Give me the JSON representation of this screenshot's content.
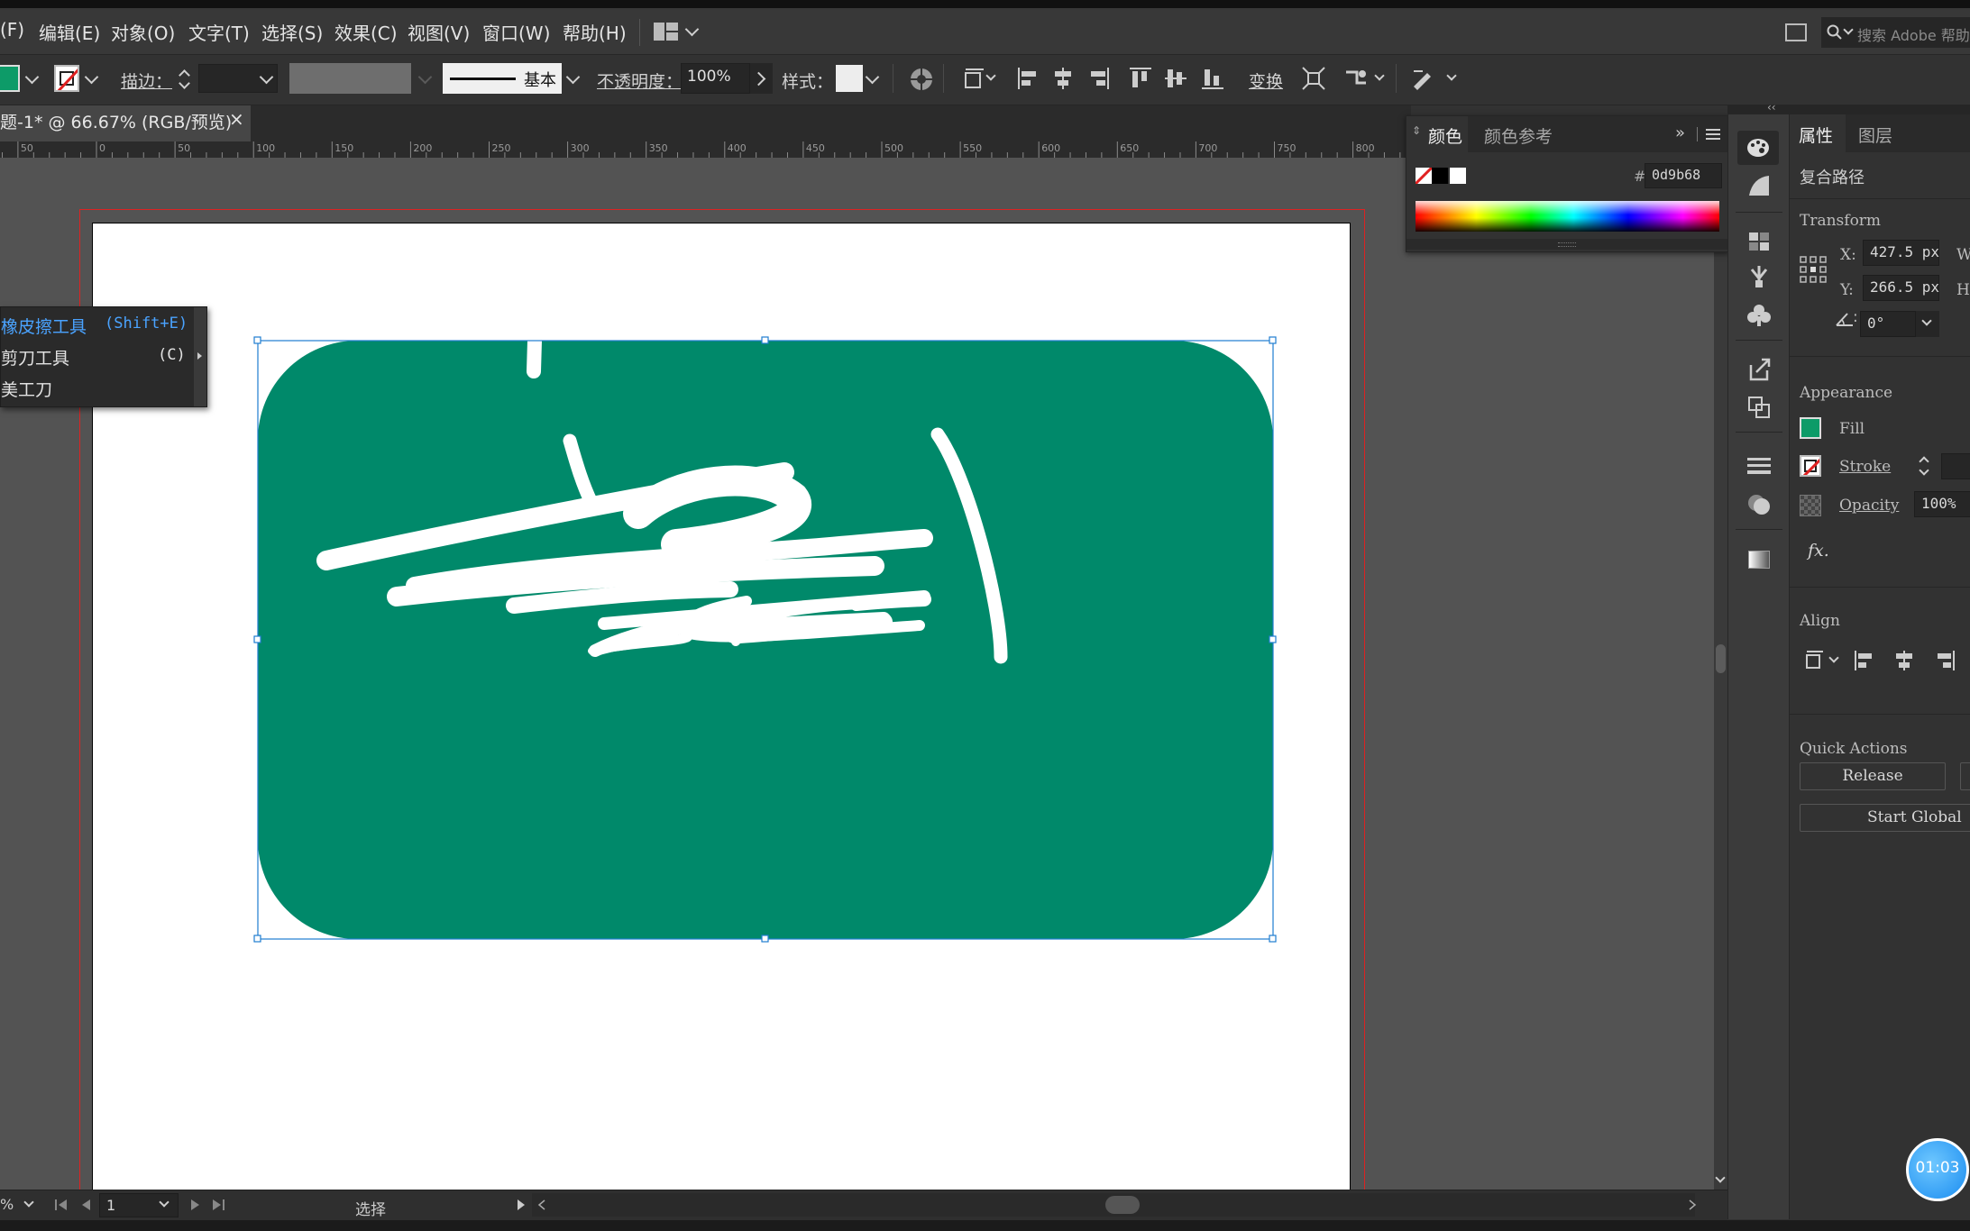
{
  "menubar": {
    "items": [
      "(F)",
      "编辑(E)",
      "对象(O)",
      "文字(T)",
      "选择(S)",
      "效果(C)",
      "视图(V)",
      "窗口(W)",
      "帮助(H)"
    ],
    "search_placeholder": "搜索 Adobe 帮助"
  },
  "controlbar": {
    "stroke_label": "描边：",
    "stroke_style": "基本",
    "opacity_label": "不透明度：",
    "opacity_value": "100%",
    "style_label": "样式：",
    "transform_label": "变换",
    "fill_color": "#0d9b68"
  },
  "document": {
    "tab_title": "题-1* @ 66.67% (RGB/预览)",
    "close": "×",
    "ruler": [
      "50",
      "0",
      "50",
      "100",
      "150",
      "200",
      "250",
      "300",
      "350",
      "400",
      "450",
      "500",
      "550",
      "600",
      "650",
      "700",
      "750",
      "800"
    ],
    "shape_color": "#00896a"
  },
  "flyout": {
    "items": [
      {
        "label": "橡皮擦工具",
        "shortcut": "(Shift+E)"
      },
      {
        "label": "剪刀工具",
        "shortcut": "(C)"
      },
      {
        "label": "美工刀",
        "shortcut": ""
      }
    ]
  },
  "color_panel": {
    "tabs": [
      "颜色",
      "颜色参考"
    ],
    "hash": "#",
    "hex_value": "0d9b68"
  },
  "properties": {
    "tabs": [
      "属性",
      "图层"
    ],
    "object_type": "复合路径",
    "transform": {
      "heading": "Transform",
      "x_label": "X:",
      "x_value": "427.5 px",
      "y_label": "Y:",
      "y_value": "266.5 px",
      "w_label": "W",
      "h_label": "H:",
      "angle_value": "0°"
    },
    "appearance": {
      "heading": "Appearance",
      "fill_label": "Fill",
      "stroke_label": "Stroke",
      "opacity_label": "Opacity",
      "opacity_value": "100%",
      "fx_label": "fx."
    },
    "align": {
      "heading": "Align"
    },
    "quick_actions": {
      "heading": "Quick Actions",
      "release_label": "Release",
      "start_global_label": "Start Global"
    }
  },
  "statusbar": {
    "zoom_suffix": "%",
    "artboard_number": "1",
    "tool_name": "选择"
  },
  "timer": {
    "value": "01:03"
  }
}
